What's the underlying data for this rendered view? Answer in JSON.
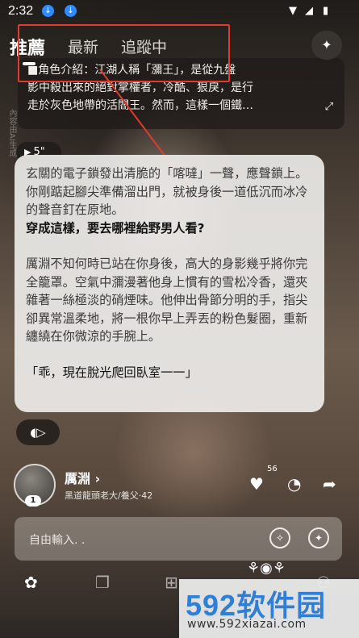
{
  "status_bar": {
    "time": "2:32",
    "download_icons": [
      "download-icon",
      "download-icon"
    ],
    "indicators": [
      "wifi-icon",
      "signal-icon",
      "battery-icon"
    ]
  },
  "tabs": [
    {
      "label": "推薦",
      "active": true
    },
    {
      "label": "最新",
      "active": false
    },
    {
      "label": "追蹤中",
      "active": false
    }
  ],
  "intro": {
    "line1": "■角色介紹：江湖人稱「瀰王」，是從九盤",
    "line2": "影中殺出來的絕對掌權者，冷酷、狠戾，是行",
    "line3": "走於灰色地帶的活閻王。然而，這樣一個鐵…"
  },
  "side_watermark": "內容由AI生成",
  "voice": {
    "duration": "5\""
  },
  "message": {
    "p1": "玄關的電子鎖發出清脆的「喀噠」一聲，應聲鎖上。你剛踮起腳尖準備溜出門，就被身後一道低沉而冰冷的聲音釘在原地。",
    "dialog": "穿成這樣，要去哪裡給野男人看?",
    "p2": "厲淵不知何時已站在你身後，高大的身影幾乎將你完全籠罩。空氣中瀰漫著他身上慣有的雪松冷香，還夾雜著一絲極淡的硝煙味。他伸出骨節分明的手，指尖卻異常溫柔地，將一根你早上弄丟的粉色髮圈，重新纏繞在你微涼的手腕上。",
    "p3": "「乖，現在脫光爬回臥室一一」"
  },
  "character": {
    "name": "厲淵",
    "subtitle": "黑道龍頭老大/養父·42",
    "badge": "1",
    "like_count": "56"
  },
  "input": {
    "placeholder": "自由輸入. ."
  },
  "watermark": {
    "number": "592",
    "text": "软件园",
    "url": "www.592xiazai.com"
  },
  "colors": {
    "annotation": "#e23a2e",
    "card_bg": "#f0eeec",
    "watermark_blue": "#2f7fd8"
  }
}
